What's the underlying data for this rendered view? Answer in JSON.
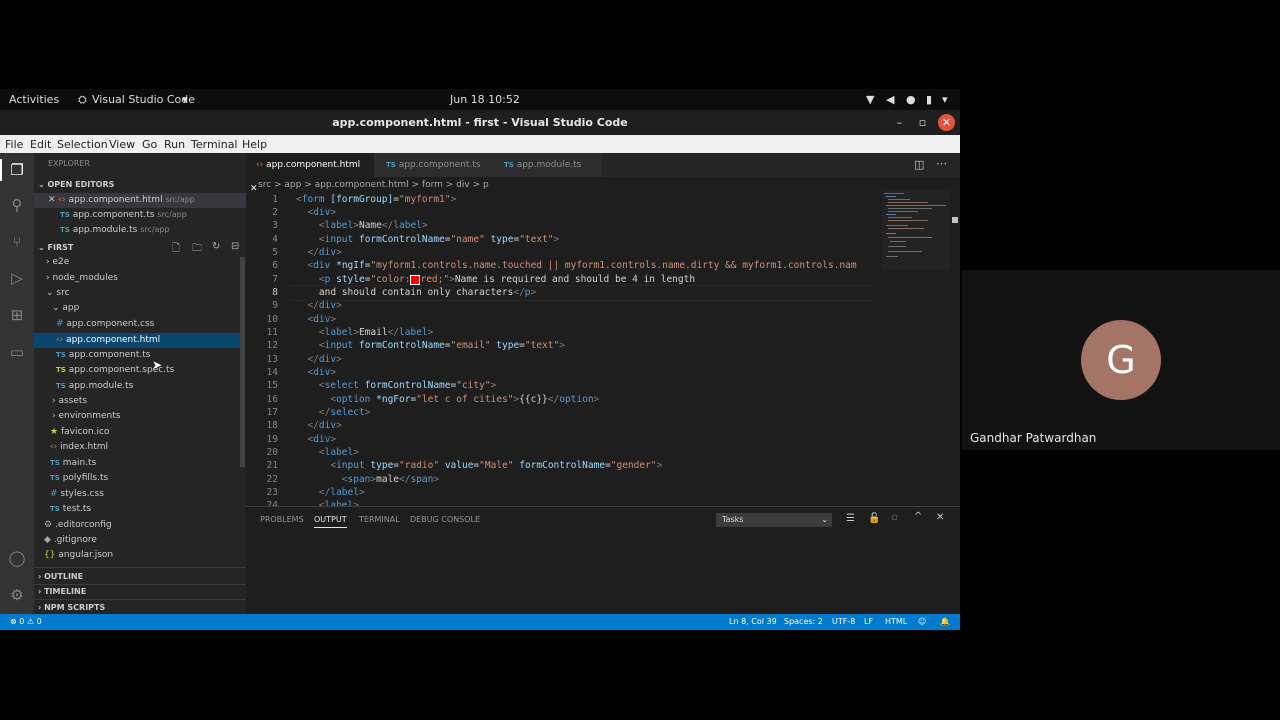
{
  "gnome": {
    "activities": "Activities",
    "app": "Visual Studio Code",
    "clock": "Jun 18  10:52"
  },
  "window": {
    "title": "app.component.html - first - Visual Studio Code"
  },
  "menu": [
    "File",
    "Edit",
    "Selection",
    "View",
    "Go",
    "Run",
    "Terminal",
    "Help"
  ],
  "sidebar": {
    "header": "EXPLORER",
    "open_editors_label": "OPEN EDITORS",
    "open_editors": [
      {
        "name": "app.component.html",
        "path": "src/app"
      },
      {
        "name": "app.component.ts",
        "path": "src/app"
      },
      {
        "name": "app.module.ts",
        "path": "src/app"
      }
    ],
    "project_label": "FIRST",
    "tree": [
      "e2e",
      "node_modules",
      "src",
      "app",
      "app.component.css",
      "app.component.html",
      "app.component.ts",
      "app.component.spec.ts",
      "app.module.ts",
      "assets",
      "environments",
      "favicon.ico",
      "index.html",
      "main.ts",
      "polyfills.ts",
      "styles.css",
      "test.ts",
      ".editorconfig",
      ".gitignore",
      "angular.json"
    ],
    "outline": "OUTLINE",
    "timeline": "TIMELINE",
    "npm": "NPM SCRIPTS"
  },
  "tabs": [
    "app.component.html",
    "app.component.ts",
    "app.module.ts"
  ],
  "breadcrumb": "src > app > app.component.html > form > div > p",
  "code_lines": [
    "1",
    "2",
    "3",
    "4",
    "5",
    "6",
    "7",
    "8",
    "9",
    "10",
    "11",
    "12",
    "13",
    "14",
    "15",
    "16",
    "17",
    "18",
    "19",
    "20",
    "21",
    "22",
    "23",
    "24"
  ],
  "panel": {
    "tabs": [
      "PROBLEMS",
      "OUTPUT",
      "TERMINAL",
      "DEBUG CONSOLE"
    ],
    "dropdown": "Tasks"
  },
  "status": {
    "problems": "⊗ 0 ⚠ 0",
    "position": "Ln 8, Col 39",
    "spaces": "Spaces: 2",
    "encoding": "UTF-8",
    "eol": "LF",
    "language": "HTML"
  },
  "participant": {
    "initial": "G",
    "name": "Gandhar Patwardhan"
  },
  "colors": {
    "statusbar": "#007acc",
    "selection": "#094771",
    "avatar": "#a47467"
  }
}
